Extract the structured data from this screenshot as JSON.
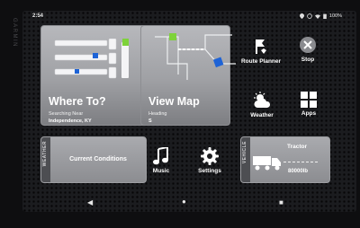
{
  "status": {
    "time": "2:54",
    "battery": "100%"
  },
  "brand": "GARMIN",
  "where_to": {
    "title": "Where To?",
    "sub_label": "Searching Near",
    "location": "Independence, KY"
  },
  "view_map": {
    "title": "View Map",
    "heading_label": "Heading",
    "heading_value": "S"
  },
  "route_planner": {
    "label": "Route Planner"
  },
  "stop": {
    "label": "Stop"
  },
  "weather": {
    "label": "Weather"
  },
  "apps": {
    "label": "Apps"
  },
  "current_conditions": {
    "tab": "WEATHER",
    "label": "Current Conditions"
  },
  "music": {
    "label": "Music"
  },
  "settings": {
    "label": "Settings"
  },
  "vehicle": {
    "tab": "VEHICLE",
    "name": "Tractor",
    "weight": "80000lb"
  },
  "colors": {
    "accent_green": "#7ed23a",
    "accent_blue": "#1e63d6",
    "tile_gray": "#a9aaae"
  }
}
